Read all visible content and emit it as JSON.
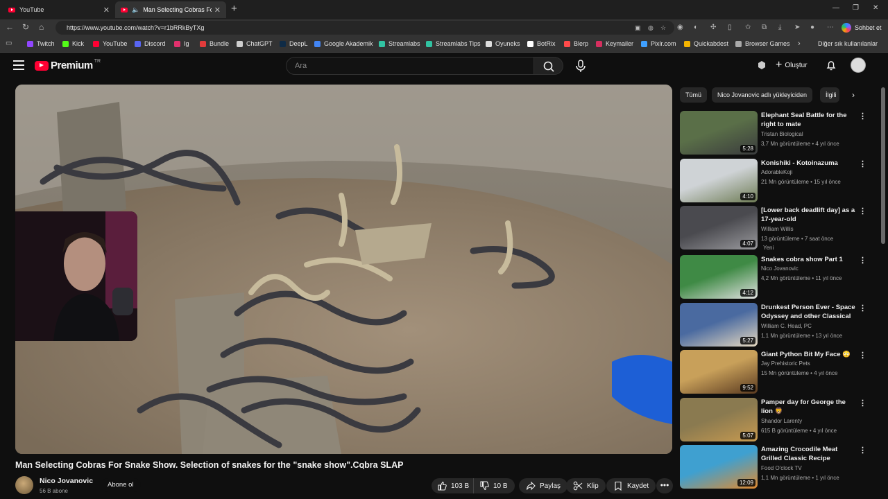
{
  "browser": {
    "tabs": [
      {
        "label": "YouTube",
        "active": false
      },
      {
        "label": "Man Selecting Cobras For Sn...",
        "active": true
      }
    ],
    "url": "https://www.youtube.com/watch?v=r1bRRkByTXg",
    "copilot_label": "Sohbet et",
    "bookmarks": [
      {
        "label": "Twitch",
        "color": "#9146ff"
      },
      {
        "label": "Kick",
        "color": "#53fc18"
      },
      {
        "label": "YouTube",
        "color": "#ff0033"
      },
      {
        "label": "Discord",
        "color": "#5865f2"
      },
      {
        "label": "Ig",
        "color": "#e1306c"
      },
      {
        "label": "Bundle",
        "color": "#e23b3b"
      },
      {
        "label": "ChatGPT",
        "color": "#cfcfcf"
      },
      {
        "label": "DeepL",
        "color": "#0f2b46"
      },
      {
        "label": "Google Akademik",
        "color": "#4285f4"
      },
      {
        "label": "Streamlabs",
        "color": "#31c3a2"
      },
      {
        "label": "Streamlabs Tips",
        "color": "#31c3a2"
      },
      {
        "label": "Oyuneks",
        "color": "#dddddd"
      },
      {
        "label": "BotRix",
        "color": "#ffffff"
      },
      {
        "label": "Blerp",
        "color": "#ff4a4a"
      },
      {
        "label": "Keymailer",
        "color": "#d62f5f"
      },
      {
        "label": "Pixlr.com",
        "color": "#3fa0ff"
      },
      {
        "label": "Quickabdest",
        "color": "#f4b400"
      },
      {
        "label": "Browser Games",
        "color": "#aaaaaa"
      }
    ],
    "bookmarks_other": "Diğer sık kullanılanlar"
  },
  "masthead": {
    "logo_text": "Premium",
    "country_code": "TR",
    "search_placeholder": "Ara",
    "create_label": "Oluştur"
  },
  "video": {
    "title": "Man Selecting Cobras For Snake Show. Selection of snakes for the \"snake show\".Cobra SLAP",
    "channel": "Nico Jovanovic",
    "subscribers": "56 B abone",
    "subscribe_label": "Abone ol",
    "likes": "103 B",
    "dislikes": "10 B",
    "share_label": "Paylaş",
    "clip_label": "Klip",
    "save_label": "Kaydet",
    "more_label": "•••"
  },
  "sidebar": {
    "chips": [
      "Tümü",
      "Nico Jovanovic adlı yükleyiciden",
      "İlgili"
    ],
    "recommendations": [
      {
        "title": "Elephant Seal Battle for the right to mate",
        "channel": "Tristan Biological",
        "meta": "3,7 Mn görüntüleme • 4 yıl önce",
        "duration": "5:28",
        "badge": ""
      },
      {
        "title": "Konishiki - Kotoinazuma",
        "channel": "AdorableKoji",
        "meta": "21 Mn görüntüleme • 15 yıl önce",
        "duration": "4:10",
        "badge": ""
      },
      {
        "title": "[Lower back deadlift day] as a 17-year-old",
        "channel": "William Willis",
        "meta": "13 görüntüleme • 7 saat önce",
        "duration": "4:07",
        "badge": "Yeni"
      },
      {
        "title": "Snakes cobra show  Part 1",
        "channel": "Nico Jovanovic",
        "meta": "4,2 Mn görüntüleme • 11 yıl önce",
        "duration": "4:12",
        "badge": ""
      },
      {
        "title": "Drunkest Person Ever - Space Odyssey and other Classical ...",
        "channel": "William C. Head, PC",
        "meta": "1,1 Mn görüntüleme • 13 yıl önce",
        "duration": "5:27",
        "badge": ""
      },
      {
        "title": "Giant Python Bit My Face 😳",
        "channel": "Jay Prehistoric Pets",
        "meta": "15 Mn görüntüleme • 4 yıl önce",
        "duration": "9:52",
        "badge": ""
      },
      {
        "title": "Pamper day for George the lion 🦁",
        "channel": "Shandor Larenty",
        "meta": "615 B görüntüleme • 4 yıl önce",
        "duration": "5:07",
        "badge": ""
      },
      {
        "title": "Amazing Crocodile Meat Grilled Classic Recipe Ingredients ...",
        "channel": "Food O'clock TV",
        "meta": "1,1 Mn görüntüleme • 1 yıl önce",
        "duration": "12:09",
        "badge": ""
      }
    ]
  }
}
